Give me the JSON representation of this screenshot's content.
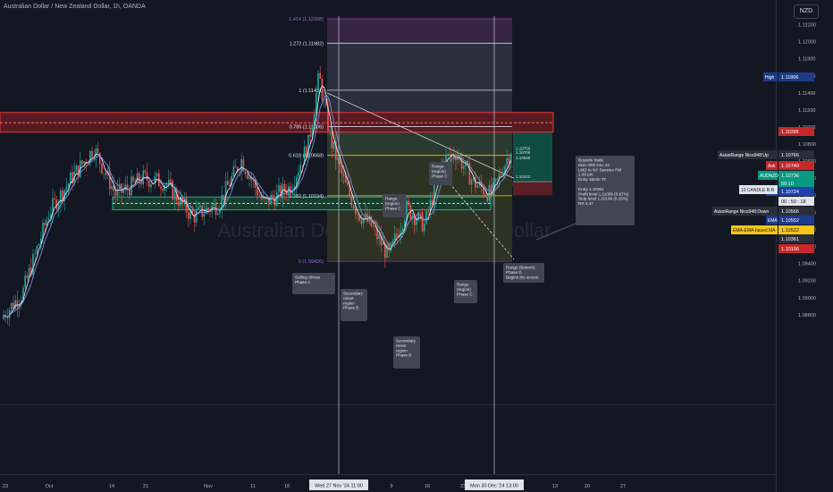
{
  "header": {
    "title": "Australian Dollar / New Zealand Dollar, 1h, OANDA",
    "currency": "NZD"
  },
  "watermark": {
    "symbol": "AUDNZD",
    "name": "Australian Dollar / New Zealand Dollar"
  },
  "chart_data": {
    "type": "candlestick",
    "price_axis": {
      "min": 1.078,
      "max": 1.124,
      "ticks": [
        "1.12200",
        "1.12000",
        "1.11800",
        "1.11600",
        "1.11400",
        "1.11200",
        "1.11000",
        "1.10800",
        "1.10600",
        "1.10400",
        "1.10200",
        "1.10000",
        "1.09800",
        "1.09600",
        "1.09400",
        "1.09200",
        "1.09000",
        "1.08800"
      ]
    },
    "x_ticks": [
      "23",
      "Oct",
      "14",
      "21",
      "Nov",
      "11",
      "18",
      "9",
      "16",
      "23",
      "13",
      "20",
      "27"
    ],
    "x_crosshair_labels": [
      "Wed 27 Nov '24  11:00",
      "Mon 30 Dec '24  13:00"
    ],
    "fib_levels": [
      {
        "ratio": "1.414",
        "price": 1.12268,
        "label": "1.414 (1.12268)"
      },
      {
        "ratio": "1.272",
        "price": 1.11982,
        "label": "1.272 (1.11982)"
      },
      {
        "ratio": "1",
        "price": 1.11431,
        "label": "1 (1.11431)"
      },
      {
        "ratio": "0.786",
        "price": 1.11006,
        "label": "0.786 (1.11006)"
      },
      {
        "ratio": "0.618",
        "price": 1.10668,
        "label": "0.618 (1.10668)"
      },
      {
        "ratio": "0.382",
        "price": 1.10194,
        "label": "0.382 (1.10194)"
      },
      {
        "ratio": "0",
        "price": 1.09426,
        "label": "0 (1.09426)"
      }
    ],
    "position_labels": [
      "1.10756",
      "1.10706",
      "1.10646",
      "1.10422"
    ],
    "right_labels": [
      {
        "text": "High",
        "value": "1.11806",
        "color": "#1e3a8a"
      },
      {
        "text": "",
        "value": "1.11099",
        "color": "#c62828"
      },
      {
        "text": "AsianRange Nico948:Up",
        "value": "1.10766",
        "color": "#2a2e39"
      },
      {
        "text": "Ask",
        "value": "1.10749",
        "color": "#c62828"
      },
      {
        "text": "AUDNZD",
        "value": "1.10736",
        "color": "#089981"
      },
      {
        "text": "",
        "value": "50:10",
        "color": "#089981"
      },
      {
        "text": "Bid",
        "value": "1.10724",
        "color": "#1e40af"
      },
      {
        "text": "10 CANDLE R:R",
        "value": "",
        "color": "#e0e3eb"
      },
      {
        "text": "",
        "value": "1.10620",
        "color": "#2a2e39"
      },
      {
        "text": "",
        "value": "00 : 50 : 18",
        "color": "#e0e3eb"
      },
      {
        "text": "AsianRange Nico948:Down",
        "value": "1.10566",
        "color": "#2a2e39"
      },
      {
        "text": "EMA",
        "value": "1.10552",
        "color": "#1e3a8a"
      },
      {
        "text": "EMA-EMA-based MA",
        "value": "1.10522",
        "color": "#f5c518"
      },
      {
        "text": "",
        "value": "1.10361",
        "color": "#2a2e39"
      },
      {
        "text": "",
        "value": "1.10196",
        "color": "#c62828"
      }
    ],
    "annotations": [
      {
        "lines": [
          "Selling climax",
          "Phase A"
        ]
      },
      {
        "lines": [
          "Secondary",
          "retest",
          "region",
          "Phase B"
        ]
      },
      {
        "lines": [
          "Secondary",
          "retest",
          "region",
          "Phase B"
        ]
      },
      {
        "lines": [
          "Range",
          "(region)",
          "Phase C"
        ]
      },
      {
        "lines": [
          "Range",
          "(region)",
          "Phase C"
        ]
      },
      {
        "lines": [
          "Range",
          "(region)",
          "Phase C"
        ]
      },
      {
        "lines": [
          "Range (Bottom)",
          "Phase D",
          "Begins the accent"
        ]
      },
      {
        "lines": [
          "Buyside trade",
          "Mon 30th Dec 24",
          "LMD to NY Session PM",
          "1.00 pm",
          "Entry 15min TF",
          "",
          "Entry 1.10361",
          "Profit level 1.11099 (0.67%)",
          "Stop level 1.10196 (0.15%)",
          "RR 4.47"
        ]
      }
    ]
  }
}
